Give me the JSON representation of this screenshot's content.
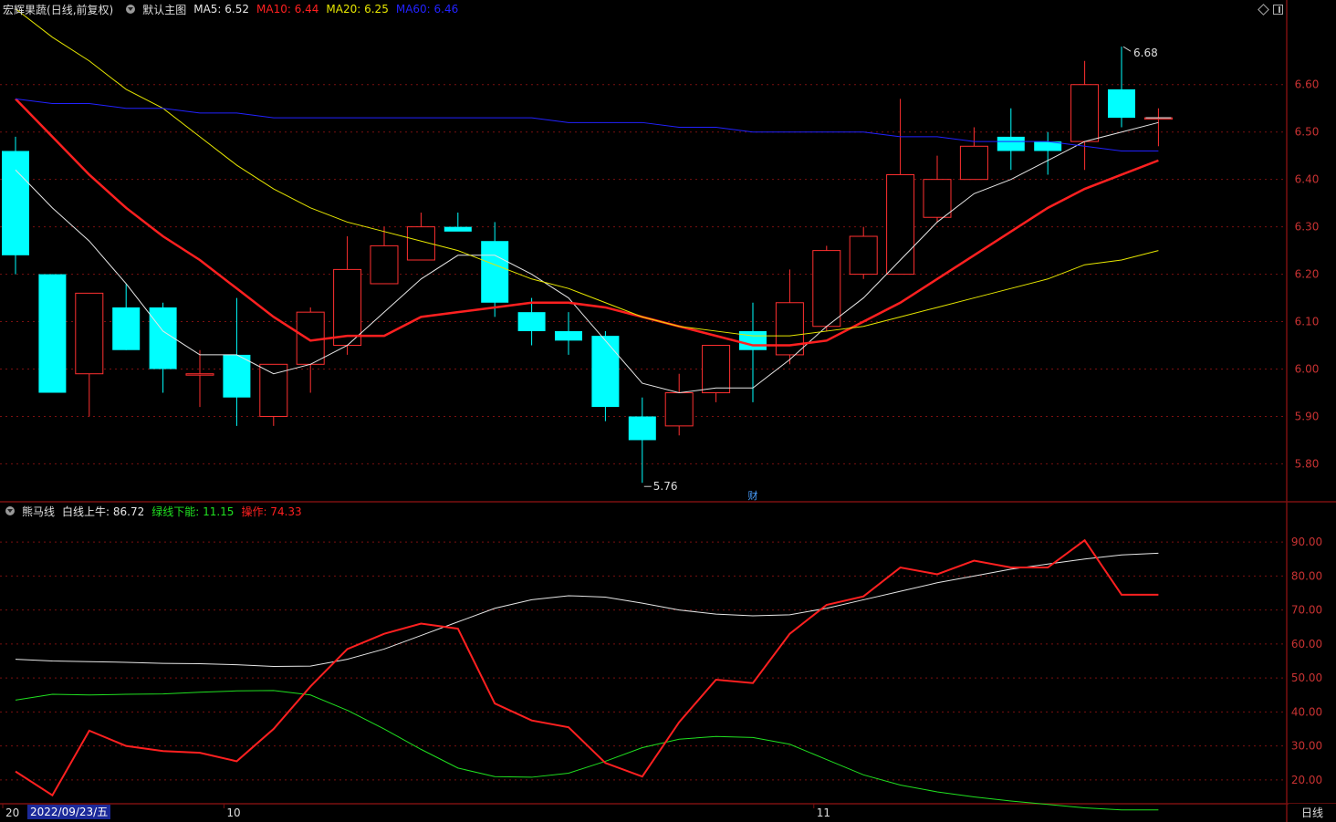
{
  "header": {
    "stock_name": "宏辉果蔬",
    "mode": "(日线,前复权)",
    "template": "默认主图",
    "ma": [
      {
        "label": "MA5:",
        "value": "6.52",
        "color": "#e6e6e6"
      },
      {
        "label": "MA10:",
        "value": "6.44",
        "color": "#ff2020"
      },
      {
        "label": "MA20:",
        "value": "6.25",
        "color": "#e6e600"
      },
      {
        "label": "MA60:",
        "value": "6.46",
        "color": "#2222ff"
      }
    ]
  },
  "indicator_header": {
    "name": "熊马线",
    "items": [
      {
        "label": "白线上牛:",
        "value": "86.72",
        "color": "#e6e6e6"
      },
      {
        "label": "绿线下能:",
        "value": "11.15",
        "color": "#20e020"
      },
      {
        "label": "操作:",
        "value": "74.33",
        "color": "#ff2020"
      }
    ]
  },
  "footer": {
    "period_tab": "日线",
    "cursor_date": "2022/09/23/五",
    "month_labels": [
      {
        "index": 0,
        "label": "20"
      },
      {
        "index": 6,
        "label": "10"
      },
      {
        "index": 22,
        "label": "11"
      }
    ]
  },
  "annotations": {
    "high_label": "6.68",
    "low_label": "5.76",
    "fin_marker": "财"
  },
  "colors": {
    "up": "#ff3030",
    "down": "#00ffff",
    "grid": "#7a1010",
    "axis_text": "#c83232"
  },
  "chart_data": [
    {
      "type": "candlestick",
      "ylim": [
        5.72,
        6.74
      ],
      "y_ticks": [
        5.8,
        5.9,
        6.0,
        6.1,
        6.2,
        6.3,
        6.4,
        6.5,
        6.6
      ],
      "candles": [
        {
          "o": 6.46,
          "h": 6.49,
          "l": 6.2,
          "c": 6.24
        },
        {
          "o": 6.2,
          "h": 6.2,
          "l": 5.95,
          "c": 5.95
        },
        {
          "o": 5.99,
          "h": 6.16,
          "l": 5.9,
          "c": 6.16
        },
        {
          "o": 6.13,
          "h": 6.18,
          "l": 6.04,
          "c": 6.04
        },
        {
          "o": 6.13,
          "h": 6.14,
          "l": 5.95,
          "c": 6.0
        },
        {
          "o": 5.99,
          "h": 6.04,
          "l": 5.92,
          "c": 5.99
        },
        {
          "o": 6.03,
          "h": 6.15,
          "l": 5.88,
          "c": 5.94
        },
        {
          "o": 5.9,
          "h": 6.01,
          "l": 5.88,
          "c": 6.01
        },
        {
          "o": 6.01,
          "h": 6.13,
          "l": 5.95,
          "c": 6.12
        },
        {
          "o": 6.05,
          "h": 6.28,
          "l": 6.03,
          "c": 6.21
        },
        {
          "o": 6.18,
          "h": 6.3,
          "l": 6.18,
          "c": 6.26
        },
        {
          "o": 6.23,
          "h": 6.33,
          "l": 6.23,
          "c": 6.3
        },
        {
          "o": 6.3,
          "h": 6.33,
          "l": 6.3,
          "c": 6.29
        },
        {
          "o": 6.27,
          "h": 6.31,
          "l": 6.11,
          "c": 6.14
        },
        {
          "o": 6.12,
          "h": 6.15,
          "l": 6.05,
          "c": 6.08
        },
        {
          "o": 6.08,
          "h": 6.12,
          "l": 6.03,
          "c": 6.06
        },
        {
          "o": 6.07,
          "h": 6.08,
          "l": 5.89,
          "c": 5.92
        },
        {
          "o": 5.9,
          "h": 5.94,
          "l": 5.76,
          "c": 5.85
        },
        {
          "o": 5.88,
          "h": 5.99,
          "l": 5.86,
          "c": 5.95
        },
        {
          "o": 5.95,
          "h": 6.05,
          "l": 5.93,
          "c": 6.05
        },
        {
          "o": 6.08,
          "h": 6.14,
          "l": 5.93,
          "c": 6.04
        },
        {
          "o": 6.03,
          "h": 6.21,
          "l": 6.01,
          "c": 6.14
        },
        {
          "o": 6.09,
          "h": 6.26,
          "l": 6.08,
          "c": 6.25
        },
        {
          "o": 6.2,
          "h": 6.3,
          "l": 6.19,
          "c": 6.28
        },
        {
          "o": 6.2,
          "h": 6.57,
          "l": 6.2,
          "c": 6.41
        },
        {
          "o": 6.32,
          "h": 6.45,
          "l": 6.31,
          "c": 6.4
        },
        {
          "o": 6.4,
          "h": 6.51,
          "l": 6.4,
          "c": 6.47
        },
        {
          "o": 6.49,
          "h": 6.55,
          "l": 6.42,
          "c": 6.46
        },
        {
          "o": 6.48,
          "h": 6.5,
          "l": 6.41,
          "c": 6.46
        },
        {
          "o": 6.48,
          "h": 6.65,
          "l": 6.42,
          "c": 6.6
        },
        {
          "o": 6.59,
          "h": 6.68,
          "l": 6.51,
          "c": 6.53
        },
        {
          "o": 6.53,
          "h": 6.55,
          "l": 6.47,
          "c": 6.53
        }
      ],
      "series": [
        {
          "name": "MA5",
          "color": "#e6e6e6",
          "width": 1,
          "values": [
            6.42,
            6.34,
            6.27,
            6.18,
            6.08,
            6.03,
            6.03,
            5.99,
            6.01,
            6.05,
            6.12,
            6.19,
            6.24,
            6.24,
            6.2,
            6.15,
            6.06,
            5.97,
            5.95,
            5.96,
            5.96,
            6.02,
            6.09,
            6.15,
            6.23,
            6.31,
            6.37,
            6.4,
            6.44,
            6.48,
            6.5,
            6.52
          ]
        },
        {
          "name": "MA10",
          "color": "#ff2020",
          "width": 2.5,
          "values": [
            6.57,
            6.49,
            6.41,
            6.34,
            6.28,
            6.23,
            6.17,
            6.11,
            6.06,
            6.07,
            6.07,
            6.11,
            6.12,
            6.13,
            6.14,
            6.14,
            6.13,
            6.11,
            6.09,
            6.07,
            6.05,
            6.05,
            6.06,
            6.1,
            6.14,
            6.19,
            6.24,
            6.29,
            6.34,
            6.38,
            6.41,
            6.44
          ]
        },
        {
          "name": "MA20",
          "color": "#e6e600",
          "width": 1,
          "values": [
            6.76,
            6.7,
            6.65,
            6.59,
            6.55,
            6.49,
            6.43,
            6.38,
            6.34,
            6.31,
            6.29,
            6.27,
            6.25,
            6.22,
            6.19,
            6.17,
            6.14,
            6.11,
            6.09,
            6.08,
            6.07,
            6.07,
            6.08,
            6.09,
            6.11,
            6.13,
            6.15,
            6.17,
            6.19,
            6.22,
            6.23,
            6.25
          ]
        },
        {
          "name": "MA60",
          "color": "#2222ff",
          "width": 1,
          "values": [
            6.57,
            6.56,
            6.56,
            6.55,
            6.55,
            6.54,
            6.54,
            6.53,
            6.53,
            6.53,
            6.53,
            6.53,
            6.53,
            6.53,
            6.53,
            6.52,
            6.52,
            6.52,
            6.51,
            6.51,
            6.5,
            6.5,
            6.5,
            6.5,
            6.49,
            6.49,
            6.48,
            6.48,
            6.48,
            6.47,
            6.46,
            6.46
          ]
        }
      ]
    },
    {
      "type": "line",
      "ylim": [
        13,
        97
      ],
      "y_ticks": [
        20.0,
        30.0,
        40.0,
        50.0,
        60.0,
        70.0,
        80.0,
        90.0
      ],
      "series": [
        {
          "name": "白线上牛",
          "color": "#e6e6e6",
          "width": 1,
          "values": [
            55.5,
            55.0,
            54.8,
            54.6,
            54.3,
            54.2,
            53.9,
            53.4,
            53.5,
            55.5,
            58.5,
            62.5,
            66.5,
            70.5,
            73.0,
            74.2,
            73.8,
            72.0,
            70.0,
            68.8,
            68.3,
            68.6,
            70.5,
            73.0,
            75.5,
            78.0,
            80.0,
            82.0,
            83.5,
            85.0,
            86.2,
            86.7
          ]
        },
        {
          "name": "绿线下能",
          "color": "#20e020",
          "width": 1,
          "values": [
            43.5,
            45.2,
            45.0,
            45.2,
            45.3,
            45.8,
            46.2,
            46.3,
            45.0,
            40.5,
            35.0,
            29.0,
            23.5,
            21.0,
            20.8,
            22.0,
            25.5,
            29.5,
            32.0,
            32.8,
            32.5,
            30.5,
            26.0,
            21.5,
            18.5,
            16.5,
            15.0,
            13.8,
            12.8,
            11.8,
            11.2,
            11.2
          ]
        },
        {
          "name": "操作",
          "color": "#ff2020",
          "width": 2,
          "values": [
            22.5,
            15.5,
            34.5,
            30.0,
            28.5,
            28.0,
            25.5,
            35.0,
            47.5,
            58.5,
            63.0,
            66.0,
            64.5,
            42.5,
            37.5,
            35.5,
            25.0,
            21.0,
            37.0,
            49.5,
            48.5,
            63.0,
            71.5,
            74.0,
            82.5,
            80.5,
            84.5,
            82.5,
            82.5,
            90.5,
            74.5,
            74.5
          ]
        }
      ]
    }
  ]
}
